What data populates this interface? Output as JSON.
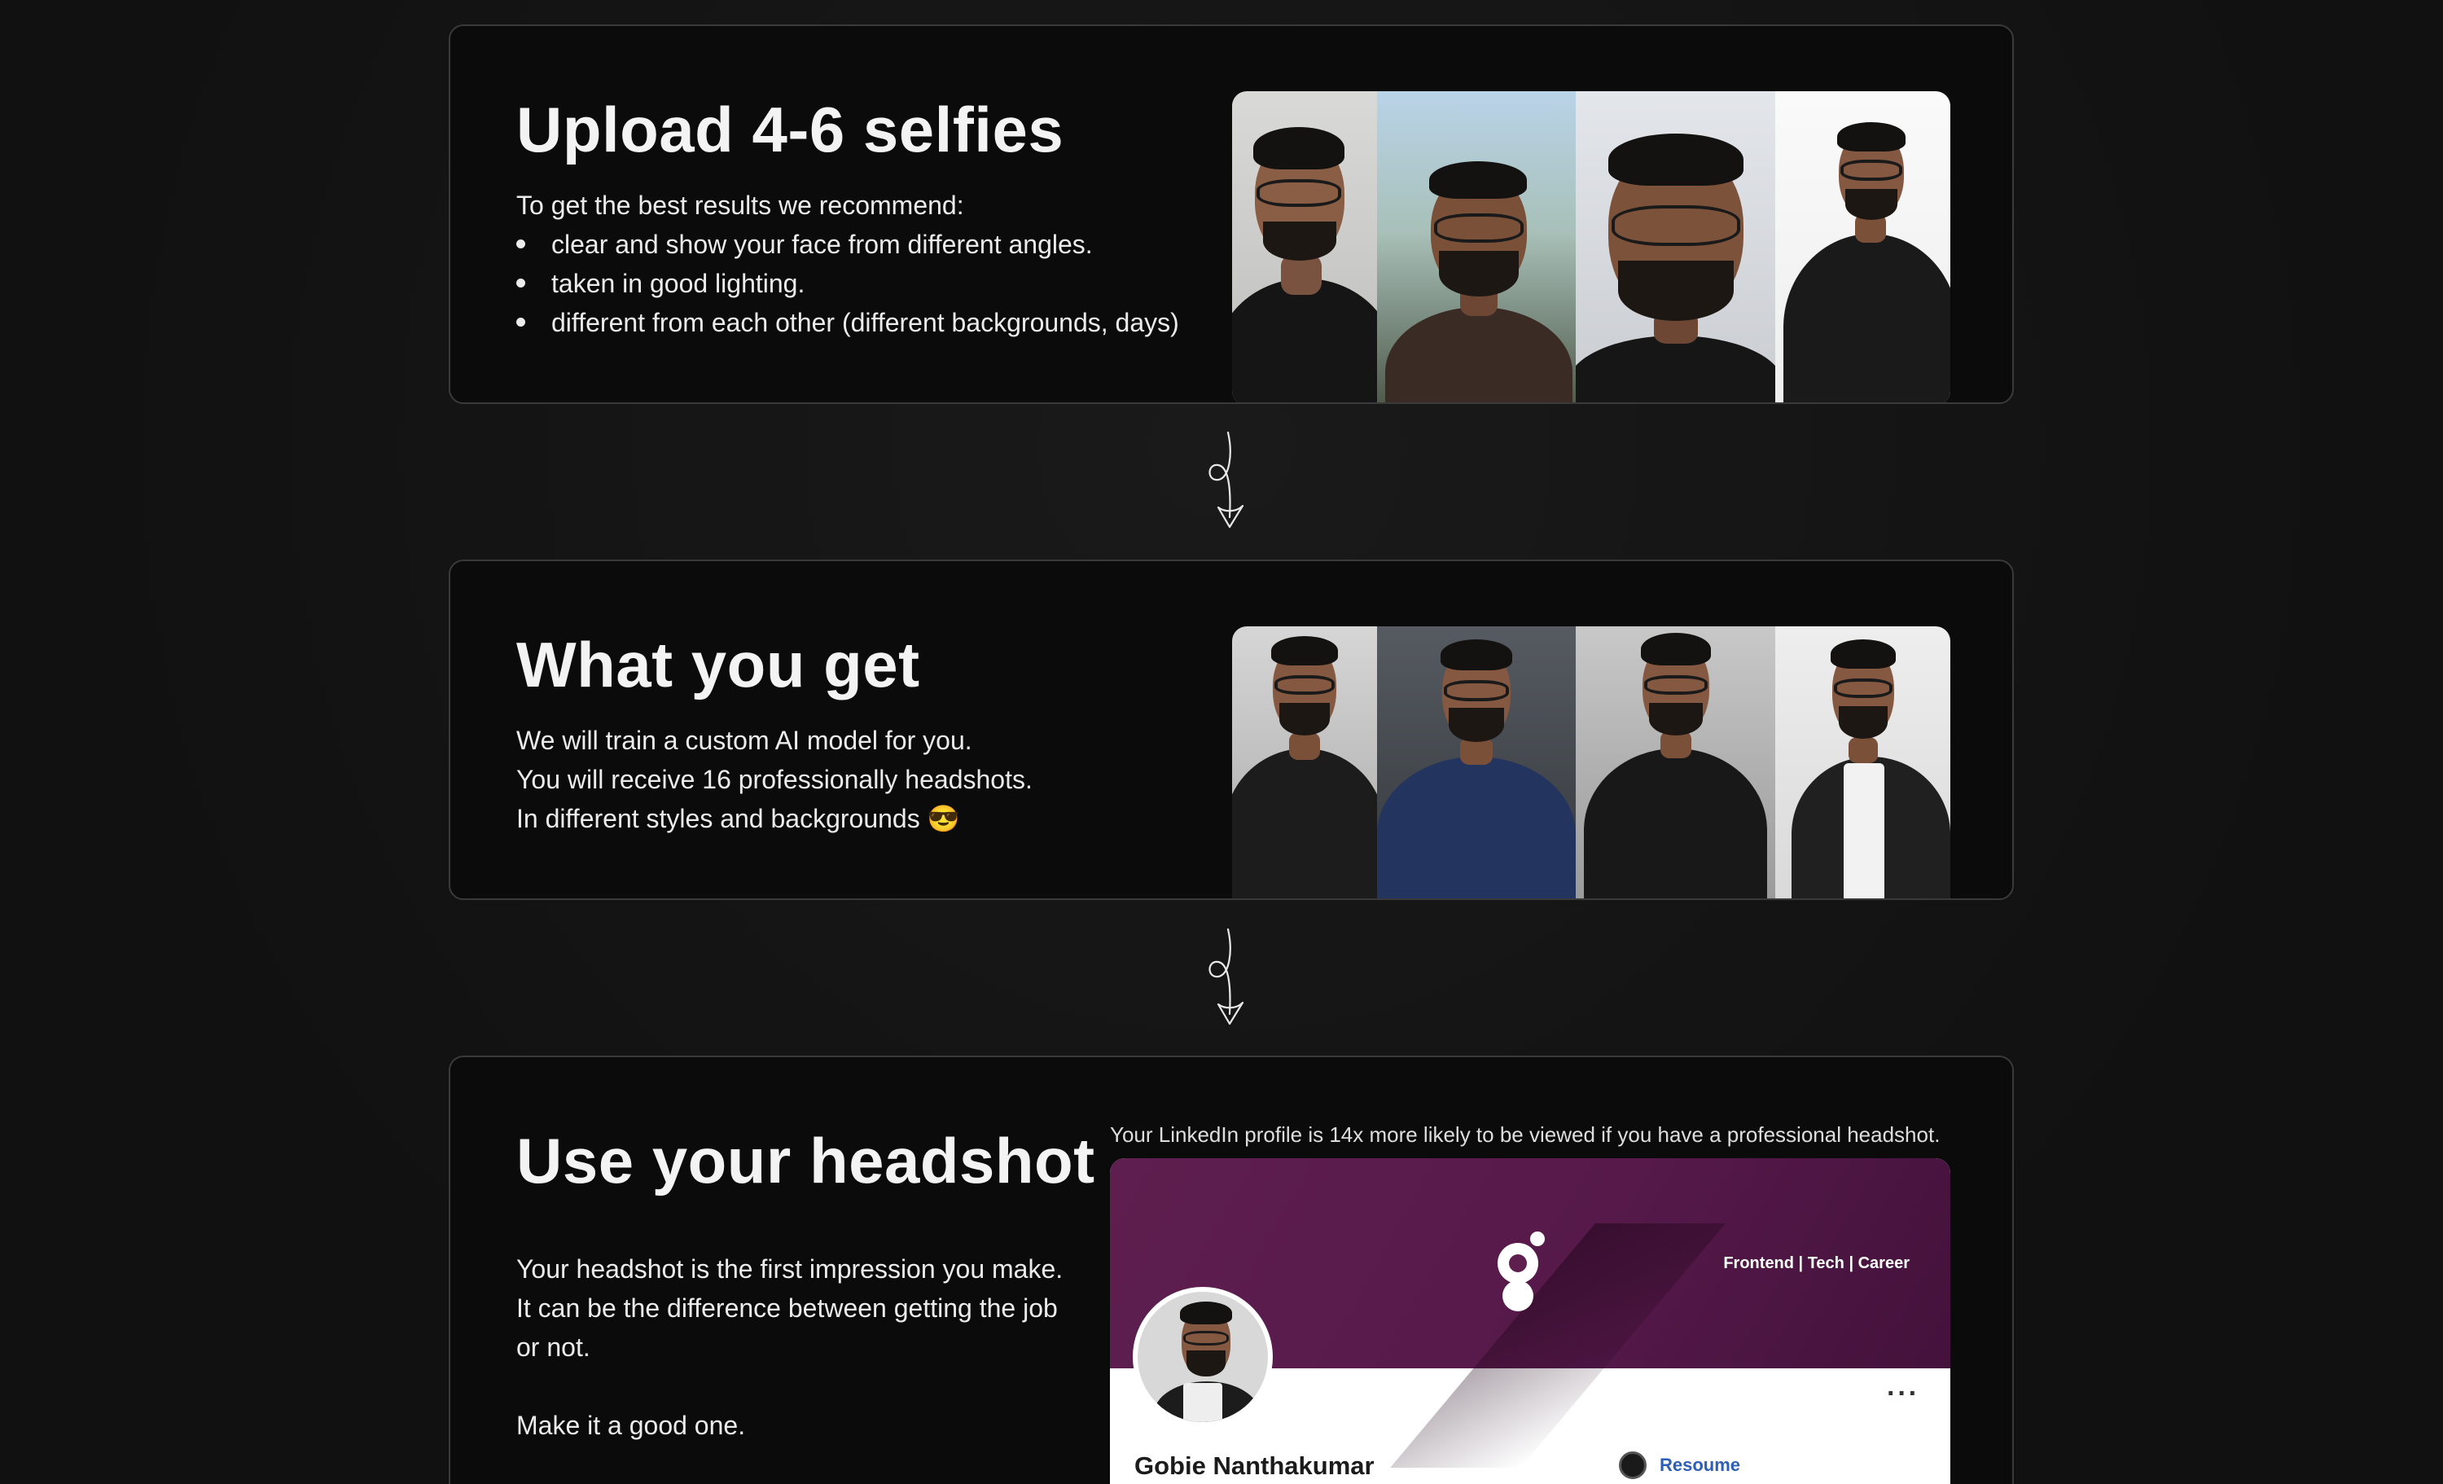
{
  "step1": {
    "title": "Upload 4-6 selfies",
    "intro": "To get the best results we recommend:",
    "bullets": [
      "clear and show your face from different angles.",
      "taken in good lighting.",
      "different from each other (different backgrounds, days)"
    ]
  },
  "step2": {
    "title": "What you get",
    "lines": [
      "We will train a custom AI model for you.",
      "You will receive 16 professionally headshots.",
      "In different styles and backgrounds 😎"
    ]
  },
  "step3": {
    "title": "Use your headshot",
    "paragraph1_lines": [
      "Your headshot is the first impression you make.",
      "It can be the difference between getting the job",
      "or not."
    ],
    "paragraph2": "Make it a good one.",
    "caption": "Your LinkedIn profile is 14x more likely to be viewed if you have a professional headshot.",
    "profile": {
      "banner_text": "Frontend | Tech | Career",
      "more_label": "···",
      "name": "Gobie Nanthakumar",
      "company": "Resoume"
    }
  },
  "icons": {
    "connector": "curly-down-arrow-icon",
    "more": "more-dots-icon",
    "company": "company-logo-icon"
  },
  "colors": {
    "background": "#121212",
    "card": "#0b0b0b",
    "card_border": "#3a3a3a",
    "banner": "#5e1f4f",
    "link": "#2d5fb6"
  }
}
